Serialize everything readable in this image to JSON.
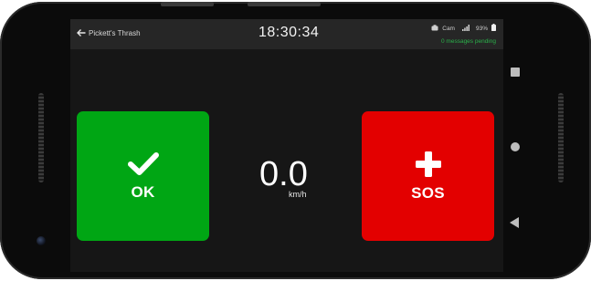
{
  "header": {
    "back_icon": "arrow-left-icon",
    "title": "Pickett's Thrash",
    "time": "18:30:34",
    "camera_label": "Cam",
    "battery": "93%",
    "pending": "0 messages pending"
  },
  "actions": {
    "ok_label": "OK",
    "ok_icon": "checkmark-icon",
    "ok_color": "#00A614",
    "sos_label": "SOS",
    "sos_icon": "plus-icon",
    "sos_color": "#E30000"
  },
  "speed": {
    "value": "0.0",
    "unit": "km/h"
  },
  "device_nav": {
    "icons": [
      "square-icon",
      "circle-icon",
      "triangle-back-icon"
    ]
  }
}
